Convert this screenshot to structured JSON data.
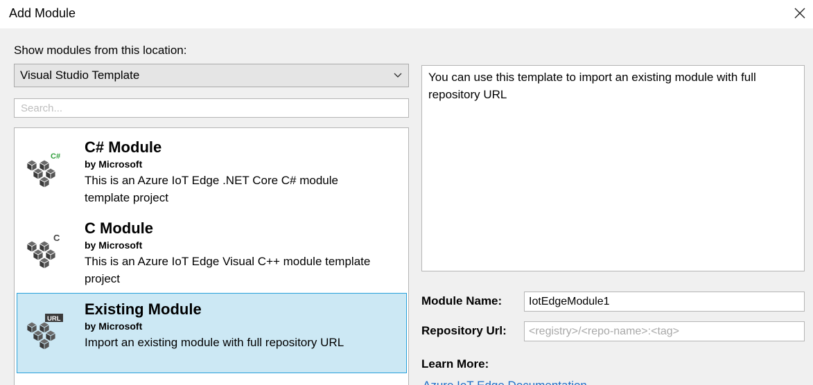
{
  "window": {
    "title": "Add Module"
  },
  "location": {
    "label": "Show modules from this location:",
    "selected": "Visual Studio Template"
  },
  "search": {
    "placeholder": "Search..."
  },
  "modules": [
    {
      "name": "C# Module",
      "author": "by Microsoft",
      "description": "This is an Azure IoT Edge .NET Core C# module template project",
      "badge": "C#",
      "badge_color": "#2e9e3a",
      "selected": false
    },
    {
      "name": "C Module",
      "author": "by Microsoft",
      "description": "This is an Azure IoT Edge Visual C++ module template project",
      "badge": "C",
      "badge_color": "#444444",
      "selected": false
    },
    {
      "name": "Existing Module",
      "author": "by Microsoft",
      "description": "Import an existing module with full repository URL",
      "badge": "URL",
      "badge_color": "#444444",
      "selected": true
    }
  ],
  "details": {
    "description": "You can use this template to import an existing module with full repository URL"
  },
  "form": {
    "module_name_label": "Module Name:",
    "module_name_value": "IotEdgeModule1",
    "repository_url_label": "Repository Url:",
    "repository_url_placeholder": "<registry>/<repo-name>:<tag>"
  },
  "learn_more": {
    "label": "Learn More:",
    "link": "Azure IoT Edge Documentation"
  },
  "colors": {
    "selection_bg": "#cce8f4",
    "selection_border": "#26a0da",
    "link": "#1e6ec8"
  }
}
